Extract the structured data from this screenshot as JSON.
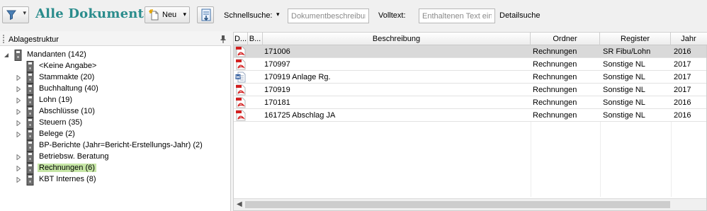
{
  "toolbar": {
    "title": "Alle Dokumente",
    "new_label": "Neu",
    "quicksearch_label": "Schnellsuche:",
    "quicksearch_placeholder": "Dokumentbeschreibung",
    "fulltext_label": "Volltext:",
    "fulltext_placeholder": "Enthaltenen Text eingeben",
    "detail_search_label": "Detailsuche"
  },
  "tree": {
    "header": "Ablagestruktur",
    "root": "Mandanten (142)",
    "items": [
      {
        "label": "<Keine Angabe>",
        "expandable": false
      },
      {
        "label": "Stammakte (20)",
        "expandable": true
      },
      {
        "label": "Buchhaltung (40)",
        "expandable": true
      },
      {
        "label": "Lohn (19)",
        "expandable": true
      },
      {
        "label": "Abschlüsse (10)",
        "expandable": true
      },
      {
        "label": "Steuern  (35)",
        "expandable": true
      },
      {
        "label": "Belege (2)",
        "expandable": true
      },
      {
        "label": "BP-Berichte (Jahr=Bericht-Erstellungs-Jahr) (2)",
        "expandable": false
      },
      {
        "label": "Betriebsw. Beratung",
        "expandable": true
      },
      {
        "label": "Rechnungen (6)",
        "expandable": true,
        "selected": true
      },
      {
        "label": "KBT Internes (8)",
        "expandable": true
      }
    ]
  },
  "grid": {
    "columns": {
      "type": "D...",
      "b": "B...",
      "beschreibung": "Beschreibung",
      "ordner": "Ordner",
      "register": "Register",
      "jahr": "Jahr"
    },
    "rows": [
      {
        "icon": "pdf-icon",
        "beschreibung": "171006",
        "ordner": "Rechnungen",
        "register": "SR Fibu/Lohn",
        "jahr": "2016",
        "selected": true
      },
      {
        "icon": "pdf-icon",
        "beschreibung": "170997",
        "ordner": "Rechnungen",
        "register": "Sonstige NL",
        "jahr": "2017"
      },
      {
        "icon": "word-icon",
        "beschreibung": "170919 Anlage Rg.",
        "ordner": "Rechnungen",
        "register": "Sonstige NL",
        "jahr": "2017"
      },
      {
        "icon": "pdf-icon",
        "beschreibung": "170919",
        "ordner": "Rechnungen",
        "register": "Sonstige NL",
        "jahr": "2017"
      },
      {
        "icon": "pdf-icon",
        "beschreibung": "170181",
        "ordner": "Rechnungen",
        "register": "Sonstige NL",
        "jahr": "2016"
      },
      {
        "icon": "pdf-icon",
        "beschreibung": "161725 Abschlag JA",
        "ordner": "Rechnungen",
        "register": "Sonstige NL",
        "jahr": "2016"
      }
    ]
  },
  "colors": {
    "accent": "#2a8c8c",
    "selected_tree": "#c6e6a6",
    "selected_row": "#d9d9d9"
  }
}
